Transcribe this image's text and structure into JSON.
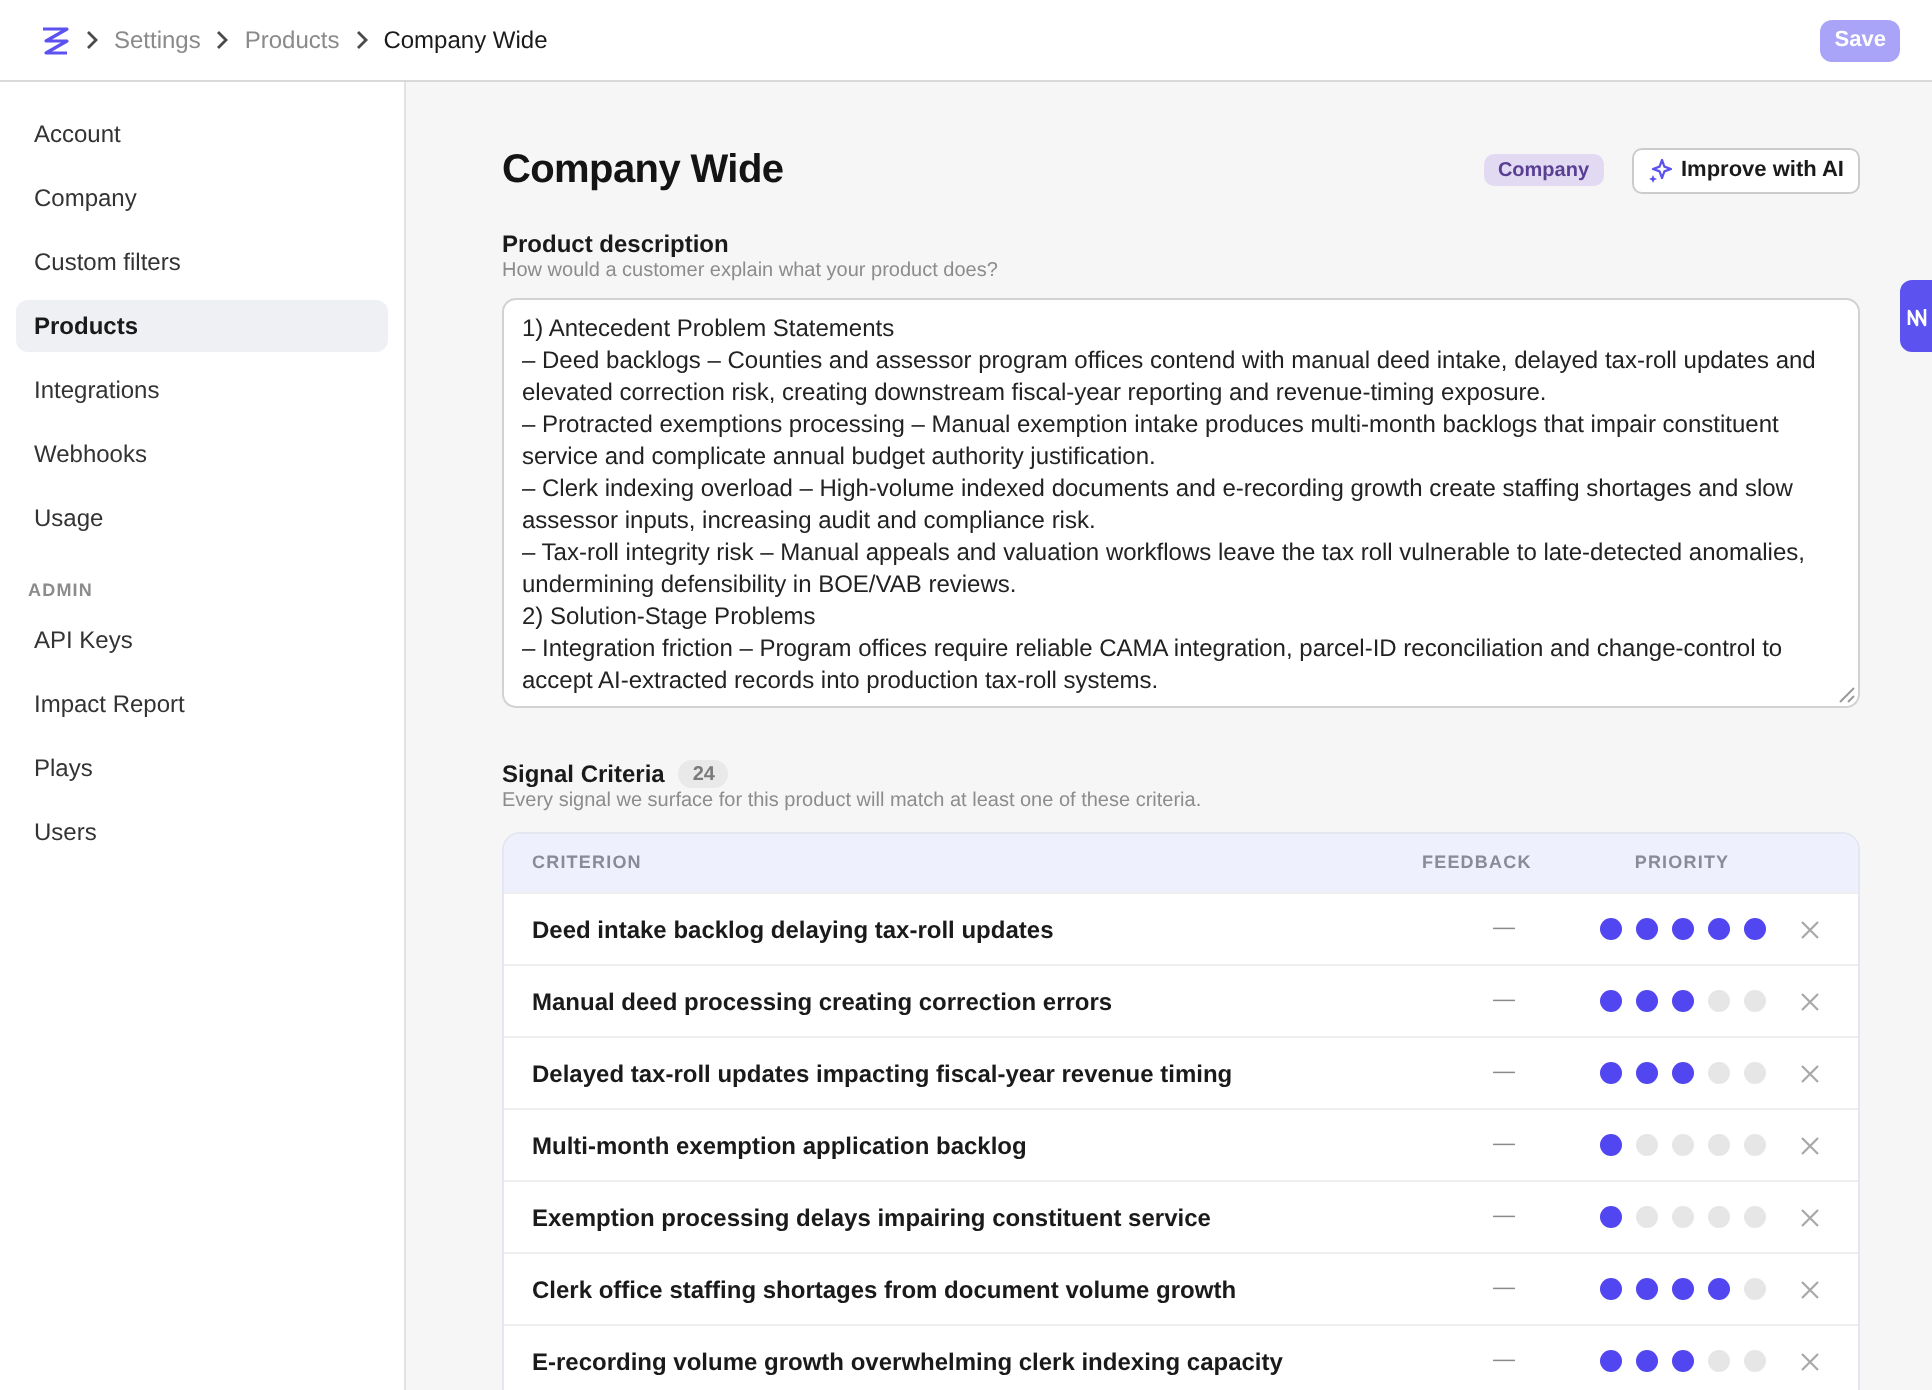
{
  "top_bar": {
    "breadcrumb": [
      {
        "label": "Settings",
        "current": false
      },
      {
        "label": "Products",
        "current": false
      },
      {
        "label": "Company Wide",
        "current": true
      }
    ],
    "save_button": {
      "label": "Save",
      "disabled": true
    }
  },
  "sidebar": {
    "groups": [
      {
        "items": [
          {
            "label": "Account",
            "selected": false
          },
          {
            "label": "Company",
            "selected": false
          },
          {
            "label": "Custom filters",
            "selected": false
          },
          {
            "label": "Products",
            "selected": true
          },
          {
            "label": "Integrations",
            "selected": false
          },
          {
            "label": "Webhooks",
            "selected": false
          },
          {
            "label": "Usage",
            "selected": false
          }
        ]
      },
      {
        "heading": "ADMIN",
        "items": [
          {
            "label": "API Keys",
            "selected": false
          },
          {
            "label": "Impact Report",
            "selected": false
          },
          {
            "label": "Plays",
            "selected": false
          },
          {
            "label": "Users",
            "selected": false
          }
        ]
      }
    ]
  },
  "header": {
    "title": "Company Wide",
    "badge": "Company",
    "improve_button": "Improve with AI"
  },
  "description": {
    "label": "Product description",
    "hint": "How would a customer explain what your product does?",
    "value": "1) Antecedent Problem Statements\n– Deed backlogs – Counties and assessor program offices contend with manual deed intake, delayed tax-roll updates and elevated correction risk, creating downstream fiscal-year reporting and revenue-timing exposure.\n– Protracted exemptions processing – Manual exemption intake produces multi-month backlogs that impair constituent service and complicate annual budget authority justification.\n– Clerk indexing overload – High-volume indexed documents and e-recording growth create staffing shortages and slow assessor inputs, increasing audit and compliance risk.\n– Tax-roll integrity risk – Manual appeals and valuation workflows leave the tax roll vulnerable to late-detected anomalies, undermining defensibility in BOE/VAB reviews.\n2) Solution-Stage Problems\n– Integration friction – Program offices require reliable CAMA integration, parcel-ID reconciliation and change-control to accept AI-extracted records into production tax-roll systems."
  },
  "criteria": {
    "title": "Signal Criteria",
    "count": "24",
    "hint": "Every signal we surface for this product will match at least one of these criteria.",
    "columns": [
      "CRITERION",
      "FEEDBACK",
      "PRIORITY"
    ],
    "rows": [
      {
        "criterion": "Deed intake backlog delaying tax-roll updates",
        "feedback": "—",
        "stars": 5
      },
      {
        "criterion": "Manual deed processing creating correction errors",
        "feedback": "—",
        "stars": 3
      },
      {
        "criterion": "Delayed tax-roll updates impacting fiscal-year revenue timing",
        "feedback": "—",
        "stars": 3
      },
      {
        "criterion": "Multi-month exemption application backlog",
        "feedback": "—",
        "stars": 1
      },
      {
        "criterion": "Exemption processing delays impairing constituent service",
        "feedback": "—",
        "stars": 1
      },
      {
        "criterion": "Clerk office staffing shortages from document volume growth",
        "feedback": "—",
        "stars": 4
      },
      {
        "criterion": "E-recording volume growth overwhelming clerk indexing capacity",
        "feedback": "—",
        "stars": 3
      }
    ]
  }
}
